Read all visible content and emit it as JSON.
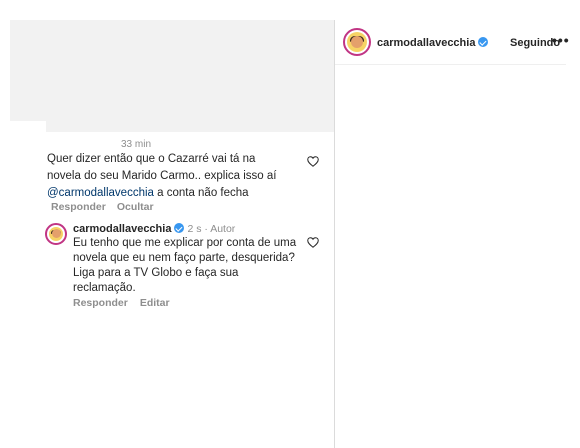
{
  "post_header": {
    "username": "carmodallavecchia",
    "following_label": "Seguindo",
    "more_label": "•••"
  },
  "comment": {
    "time": "33 min",
    "text_part1": "Quer dizer então que o Cazarré vai tá na novela do seu Marido Carmo.. explica isso aí ",
    "mention": "@carmodallavecchia",
    "text_part2": "  a conta não fecha",
    "reply_label": "Responder",
    "hide_label": "Ocultar"
  },
  "reply": {
    "username": "carmodallavecchia",
    "meta": "2 s · Autor",
    "text": "Eu tenho que me explicar por conta de uma novela que eu nem faço parte, desquerida? Liga para a TV Globo e faça sua reclamação.",
    "reply_label": "Responder",
    "edit_label": "Editar"
  },
  "colors": {
    "verified": "#3897f0",
    "secondary_text": "#8e8e8e",
    "mention": "#00376b"
  }
}
